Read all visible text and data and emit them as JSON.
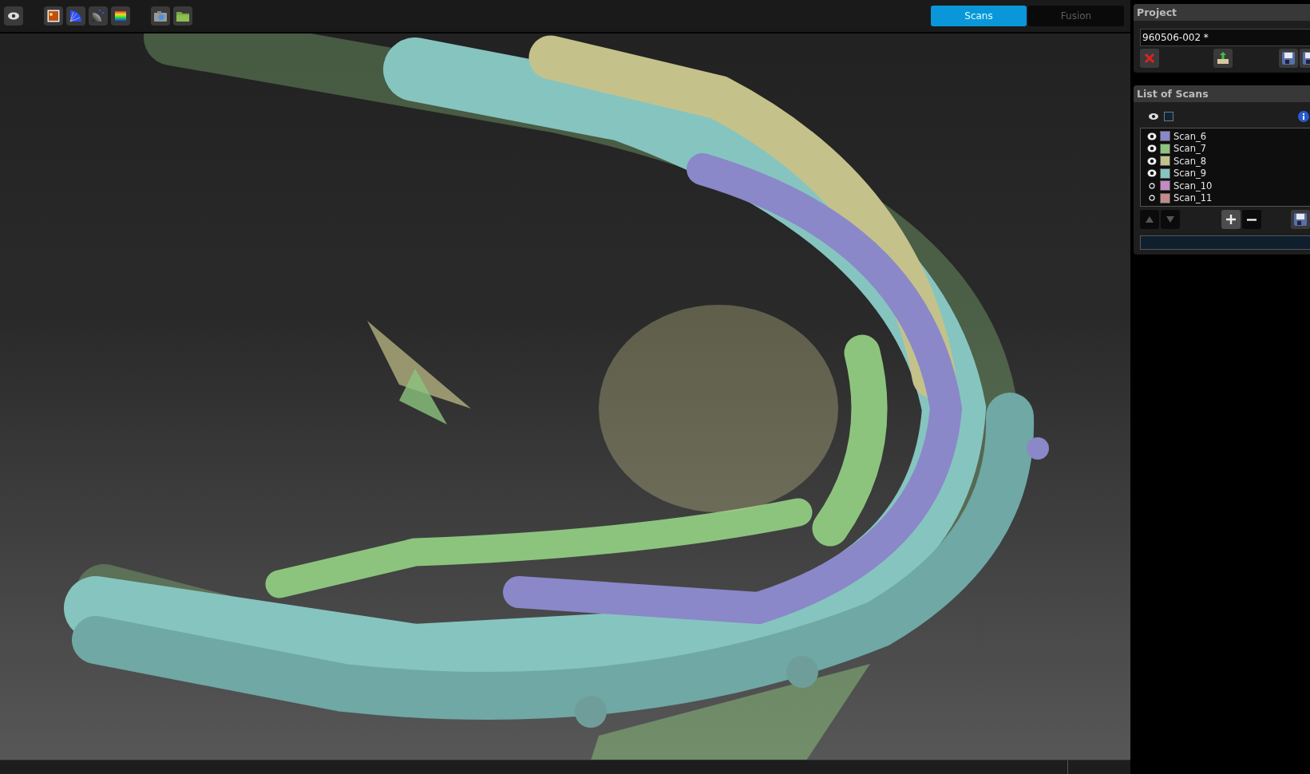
{
  "toolbar": {
    "tools": [
      {
        "kind": "eye"
      },
      {
        "kind": "image"
      },
      {
        "kind": "fan"
      },
      {
        "kind": "gradient"
      },
      {
        "kind": "rainbow"
      },
      {
        "kind": "camera"
      },
      {
        "kind": "folder"
      }
    ]
  },
  "mode_tabs": [
    {
      "label": "Scans",
      "selected": true
    },
    {
      "label": "Fusion",
      "selected": false
    }
  ],
  "project": {
    "title": "Project",
    "name": "960506-002 *"
  },
  "scan_list": {
    "title": "List of Scans",
    "all_checked": false,
    "progress": {
      "level": 0
    },
    "scans": [
      {
        "name": "Scan_6",
        "visible": true,
        "color": "#8a88c8"
      },
      {
        "name": "Scan_7",
        "visible": true,
        "color": "#8cc47e"
      },
      {
        "name": "Scan_8",
        "visible": true,
        "color": "#c4c28a"
      },
      {
        "name": "Scan_9",
        "visible": true,
        "color": "#86c4c0"
      },
      {
        "name": "Scan_10",
        "visible": false,
        "color": "#c48ac4"
      },
      {
        "name": "Scan_11",
        "visible": false,
        "color": "#c48a8a"
      }
    ]
  }
}
